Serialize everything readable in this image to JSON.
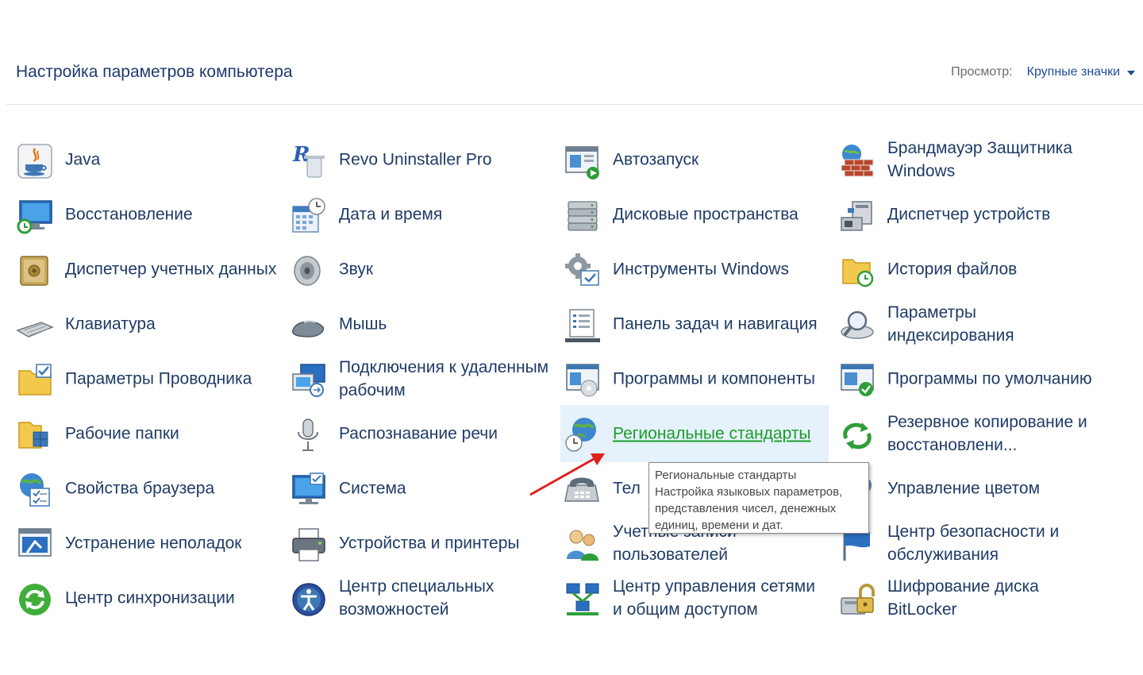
{
  "header": {
    "title": "Настройка параметров компьютера",
    "view_label": "Просмотр:",
    "view_value": "Крупные значки"
  },
  "items": [
    {
      "label": "Java",
      "icon": "java-icon"
    },
    {
      "label": "Revo Uninstaller Pro",
      "icon": "revo-uninstaller-icon"
    },
    {
      "label": "Автозапуск",
      "icon": "autoplay-icon"
    },
    {
      "label": "Брандмауэр Защитника Windows",
      "icon": "firewall-icon"
    },
    {
      "label": "Восстановление",
      "icon": "recovery-icon"
    },
    {
      "label": "Дата и время",
      "icon": "calendar-clock-icon"
    },
    {
      "label": "Дисковые пространства",
      "icon": "storage-spaces-icon"
    },
    {
      "label": "Диспетчер устройств",
      "icon": "device-manager-icon"
    },
    {
      "label": "Диспетчер учетных данных",
      "icon": "credential-vault-icon"
    },
    {
      "label": "Звук",
      "icon": "speaker-icon"
    },
    {
      "label": "Инструменты Windows",
      "icon": "gear-tools-icon"
    },
    {
      "label": "История файлов",
      "icon": "file-history-icon"
    },
    {
      "label": "Клавиатура",
      "icon": "keyboard-icon"
    },
    {
      "label": "Мышь",
      "icon": "mouse-icon"
    },
    {
      "label": "Панель задач и навигация",
      "icon": "taskbar-icon"
    },
    {
      "label": "Параметры индексирования",
      "icon": "indexing-icon"
    },
    {
      "label": "Параметры Проводника",
      "icon": "folder-options-icon"
    },
    {
      "label": "Подключения к удаленным рабочим",
      "icon": "remote-desktop-icon"
    },
    {
      "label": "Программы и компоненты",
      "icon": "programs-features-icon"
    },
    {
      "label": "Программы по умолчанию",
      "icon": "default-programs-icon"
    },
    {
      "label": "Рабочие папки",
      "icon": "work-folders-icon"
    },
    {
      "label": "Распознавание речи",
      "icon": "microphone-icon"
    },
    {
      "label": "Региональные стандарты",
      "icon": "globe-clock-icon"
    },
    {
      "label": "Резервное копирование и восстановлени...",
      "icon": "backup-restore-icon"
    },
    {
      "label": "Свойства браузера",
      "icon": "internet-options-icon"
    },
    {
      "label": "Система",
      "icon": "system-monitor-icon"
    },
    {
      "label": "Тел",
      "icon": "phone-modem-icon"
    },
    {
      "label": "Управление цветом",
      "icon": "color-management-icon"
    },
    {
      "label": "Устранение неполадок",
      "icon": "troubleshooting-icon"
    },
    {
      "label": "Устройства и принтеры",
      "icon": "printer-icon"
    },
    {
      "label": "Учетные записи пользователей",
      "icon": "users-icon"
    },
    {
      "label": "Центр безопасности и обслуживания",
      "icon": "security-flag-icon"
    },
    {
      "label": "Центр синхронизации",
      "icon": "sync-center-icon"
    },
    {
      "label": "Центр специальных возможностей",
      "icon": "accessibility-icon"
    },
    {
      "label": "Центр управления сетями и общим доступом",
      "icon": "network-center-icon"
    },
    {
      "label": "Шифрование диска BitLocker",
      "icon": "bitlocker-icon"
    }
  ],
  "highlighted_index": 22,
  "tooltip": {
    "title": "Региональные стандарты",
    "line1": "Настройка языковых параметров,",
    "line2": "представления чисел, денежных",
    "line3": "единиц, времени и дат."
  },
  "colors": {
    "title": "#1e3a6e",
    "link": "#1f3b66",
    "highlight_text": "#1a9e2a",
    "highlight_bg": "#e5f1fb",
    "arrow": "#e0201c"
  }
}
